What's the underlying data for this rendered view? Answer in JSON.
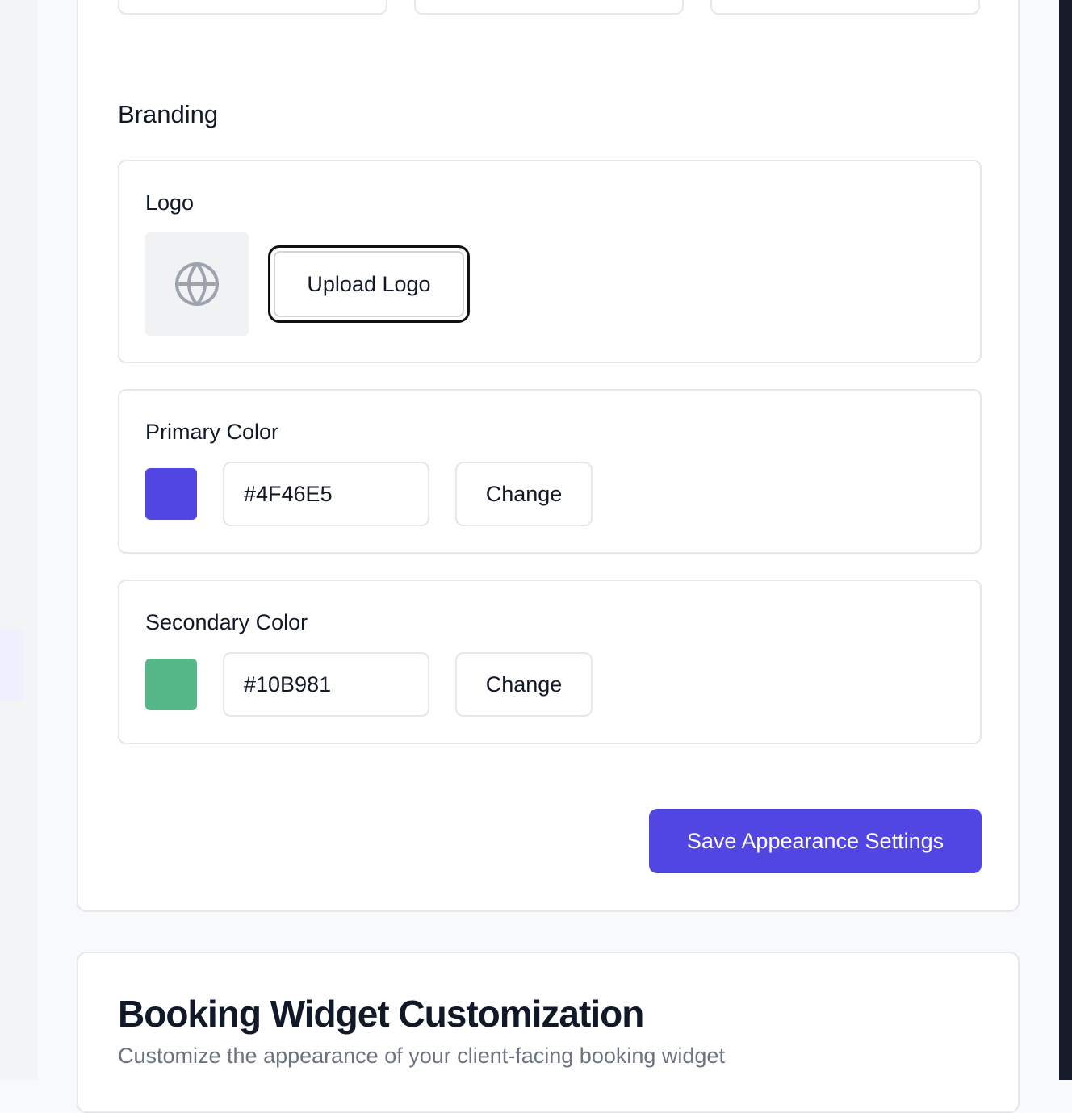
{
  "appearance": {
    "branding_heading": "Branding",
    "logo": {
      "label": "Logo",
      "placeholder_icon": "globe-icon",
      "upload_label": "Upload Logo"
    },
    "primary_color": {
      "label": "Primary Color",
      "value": "#4F46E5",
      "swatch": "#5246e3",
      "change_label": "Change"
    },
    "secondary_color": {
      "label": "Secondary Color",
      "value": "#10B981",
      "swatch": "#55b787",
      "change_label": "Change"
    },
    "save_label": "Save Appearance Settings"
  },
  "booking_widget": {
    "title": "Booking Widget Customization",
    "subtitle": "Customize the appearance of your client-facing booking widget"
  },
  "colors": {
    "accent": "#5246e3",
    "right_edge": "#161a29"
  }
}
